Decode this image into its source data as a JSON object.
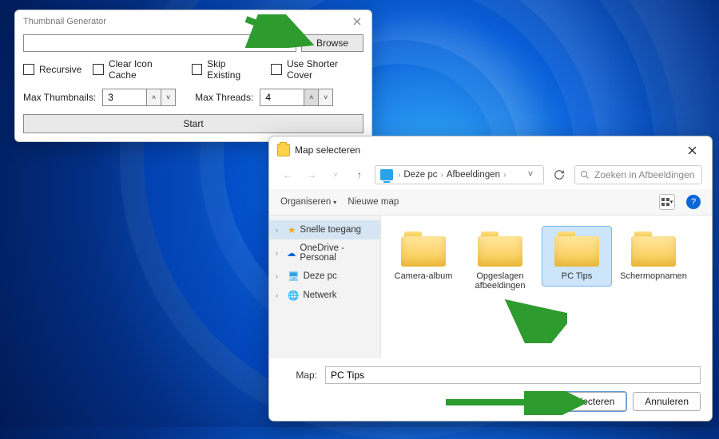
{
  "tg": {
    "title": "Thumbnail Generator",
    "path_value": "",
    "browse": "Browse",
    "options": {
      "recursive": "Recursive",
      "clear_cache": "Clear Icon Cache",
      "skip_existing": "Skip Existing",
      "shorter_cover": "Use Shorter Cover"
    },
    "max_thumbs_label": "Max Thumbnails:",
    "max_thumbs_value": "3",
    "max_threads_label": "Max Threads:",
    "max_threads_value": "4",
    "start": "Start"
  },
  "dlg": {
    "title": "Map selecteren",
    "crumb": {
      "root": "Deze pc",
      "folder": "Afbeeldingen"
    },
    "search_placeholder": "Zoeken in Afbeeldingen",
    "toolbar": {
      "organize": "Organiseren",
      "new_folder": "Nieuwe map"
    },
    "tree": [
      {
        "label": "Snelle toegang",
        "icon": "star",
        "selected": true
      },
      {
        "label": "OneDrive - Personal",
        "icon": "cloud",
        "selected": false
      },
      {
        "label": "Deze pc",
        "icon": "pc",
        "selected": false
      },
      {
        "label": "Netwerk",
        "icon": "globe",
        "selected": false
      }
    ],
    "folders": [
      {
        "name": "Camera-album",
        "selected": false
      },
      {
        "name": "Opgeslagen afbeeldingen",
        "selected": false
      },
      {
        "name": "PC Tips",
        "selected": true
      },
      {
        "name": "Schermopnamen",
        "selected": false
      }
    ],
    "field_label": "Map:",
    "field_value": "PC Tips",
    "select_btn": "Map selecteren",
    "cancel_btn": "Annuleren"
  }
}
